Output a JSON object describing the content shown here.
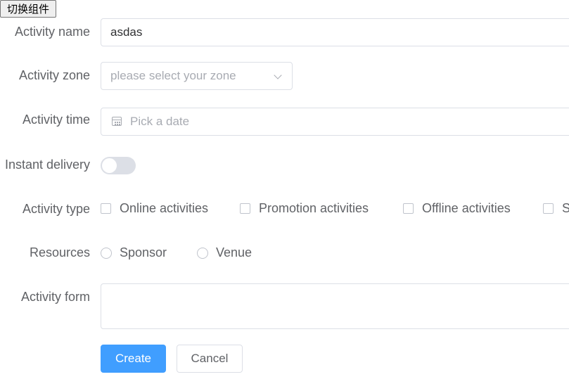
{
  "toolbar": {
    "switch_label": "切换组件"
  },
  "form": {
    "name": {
      "label": "Activity name",
      "value": "asdas"
    },
    "zone": {
      "label": "Activity zone",
      "placeholder": "please select your zone"
    },
    "time": {
      "label": "Activity time",
      "placeholder": "Pick a date"
    },
    "delivery": {
      "label": "Instant delivery",
      "enabled": false
    },
    "type": {
      "label": "Activity type",
      "options": [
        "Online activities",
        "Promotion activities",
        "Offline activities",
        "S"
      ]
    },
    "resources": {
      "label": "Resources",
      "options": [
        "Sponsor",
        "Venue"
      ]
    },
    "form_desc": {
      "label": "Activity form",
      "value": ""
    },
    "actions": {
      "create": "Create",
      "cancel": "Cancel"
    }
  },
  "colors": {
    "primary": "#409eff",
    "border": "#dcdfe6",
    "text": "#606266",
    "placeholder": "#a8abb2"
  }
}
